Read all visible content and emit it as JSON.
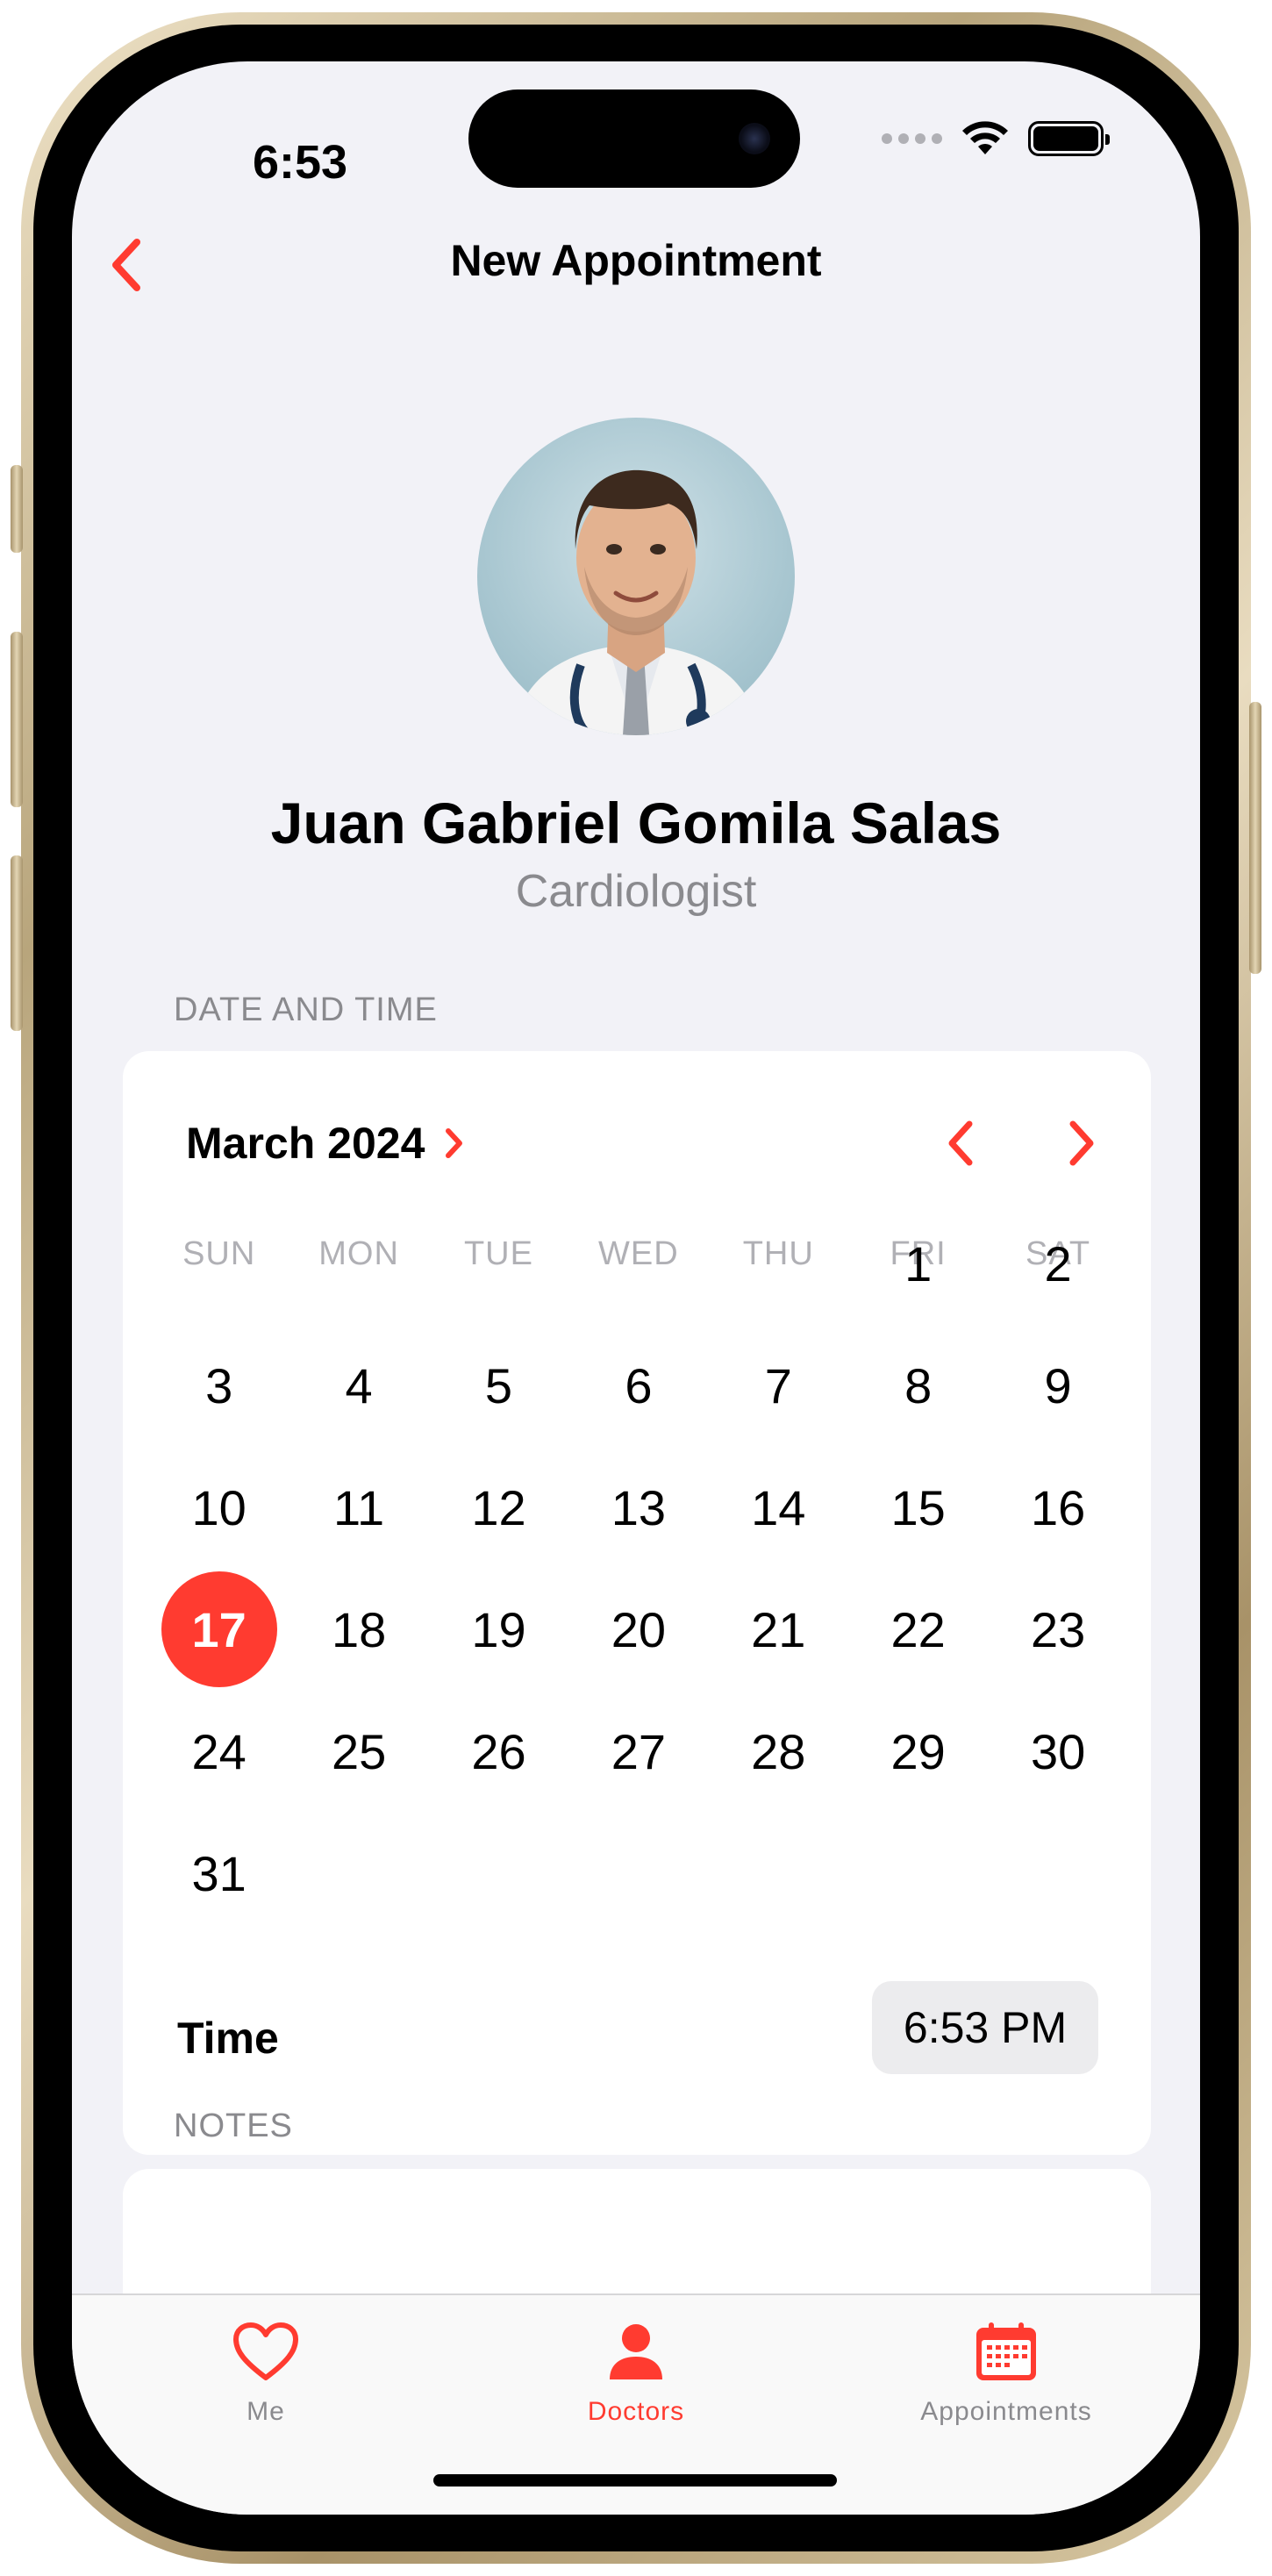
{
  "status_bar": {
    "time": "6:53"
  },
  "nav": {
    "title": "New Appointment",
    "back_icon": "chevron-left-icon"
  },
  "doctor": {
    "name": "Juan Gabriel Gomila Salas",
    "specialty": "Cardiologist"
  },
  "date_section": {
    "label": "DATE AND TIME",
    "month_label": "March 2024",
    "weekdays": [
      "SUN",
      "MON",
      "TUE",
      "WED",
      "THU",
      "FRI",
      "SAT"
    ],
    "days": [
      "1",
      "2",
      "3",
      "4",
      "5",
      "6",
      "7",
      "8",
      "9",
      "10",
      "11",
      "12",
      "13",
      "14",
      "15",
      "16",
      "17",
      "18",
      "19",
      "20",
      "21",
      "22",
      "23",
      "24",
      "25",
      "26",
      "27",
      "28",
      "29",
      "30",
      "31"
    ],
    "selected_day": "17",
    "time_label": "Time",
    "time_value": "6:53 PM"
  },
  "notes_section": {
    "label": "NOTES"
  },
  "tabs": [
    {
      "label": "Me",
      "icon": "heart-icon",
      "active": false
    },
    {
      "label": "Doctors",
      "icon": "person-icon",
      "active": true
    },
    {
      "label": "Appointments",
      "icon": "calendar-icon",
      "active": false
    }
  ],
  "colors": {
    "accent": "#ff3b30",
    "secondary_text": "#8a8a8e",
    "background": "#f2f2f7",
    "inactive_tab": "#8a8a8e"
  }
}
